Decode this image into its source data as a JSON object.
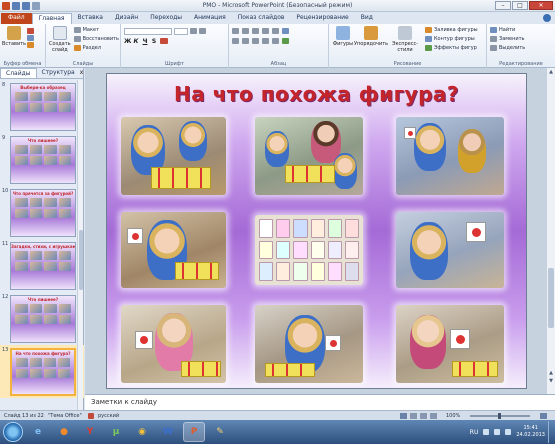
{
  "window": {
    "title": "РМО - Microsoft PowerPoint (Безопасный режим)"
  },
  "ribbon": {
    "tabs": [
      "Файл",
      "Главная",
      "Вставка",
      "Дизайн",
      "Переходы",
      "Анимация",
      "Показ слайдов",
      "Рецензирование",
      "Вид"
    ],
    "active_tab": "Главная",
    "clipboard": {
      "paste": "Вставить",
      "label": "Буфер обмена"
    },
    "slides": {
      "new_slide": "Создать слайд",
      "layout": "Макет",
      "reset": "Восстановить",
      "section": "Раздел",
      "label": "Слайды"
    },
    "font": {
      "bold": "Ж",
      "italic": "К",
      "underline": "Ч",
      "strike": "S",
      "label": "Шрифт"
    },
    "paragraph": {
      "label": "Абзац"
    },
    "drawing": {
      "shapes": "Фигуры",
      "arrange": "Упорядочить",
      "quick_styles": "Экспресс-стили",
      "fill": "Заливка фигуры",
      "outline": "Контур фигуры",
      "effects": "Эффекты фигур",
      "label": "Рисование"
    },
    "editing": {
      "find": "Найти",
      "replace": "Заменить",
      "select": "Выделить",
      "label": "Редактирование"
    }
  },
  "left_pane": {
    "tabs": [
      "Слайды",
      "Структура"
    ],
    "active_tab": "Слайды",
    "close": "x",
    "thumbnails": [
      {
        "number": "8",
        "title": "Выбери-ка образец",
        "selected": false
      },
      {
        "number": "9",
        "title": "Что лишнее?",
        "selected": false
      },
      {
        "number": "10",
        "title": "Что прячется за фигурой?",
        "selected": false
      },
      {
        "number": "11",
        "title": "Загадки, стихи, с игрушками",
        "selected": false
      },
      {
        "number": "12",
        "title": "Что лишнее?",
        "selected": false
      },
      {
        "number": "13",
        "title": "На что похожа фигура?",
        "selected": true
      }
    ]
  },
  "slide": {
    "title": "На что похожа фигура?"
  },
  "notes": {
    "placeholder": "Заметки к слайду"
  },
  "statusbar": {
    "slide_info": "Слайд 13 из 22",
    "theme": "\"Тема Office\"",
    "language": "русский",
    "zoom": "100%"
  },
  "taskbar": {
    "apps": [
      "ie",
      "firefox",
      "yandex",
      "utorrent",
      "chrome",
      "word",
      "powerpoint",
      "paint"
    ],
    "language": "RU",
    "time": "15:41",
    "date": "24.02.2013"
  },
  "colors": {
    "title_red": "#c3252b",
    "slide_purple": "#a46ad6",
    "file_tab": "#c0451b",
    "taskbar_blue": "#2d4f7c"
  }
}
